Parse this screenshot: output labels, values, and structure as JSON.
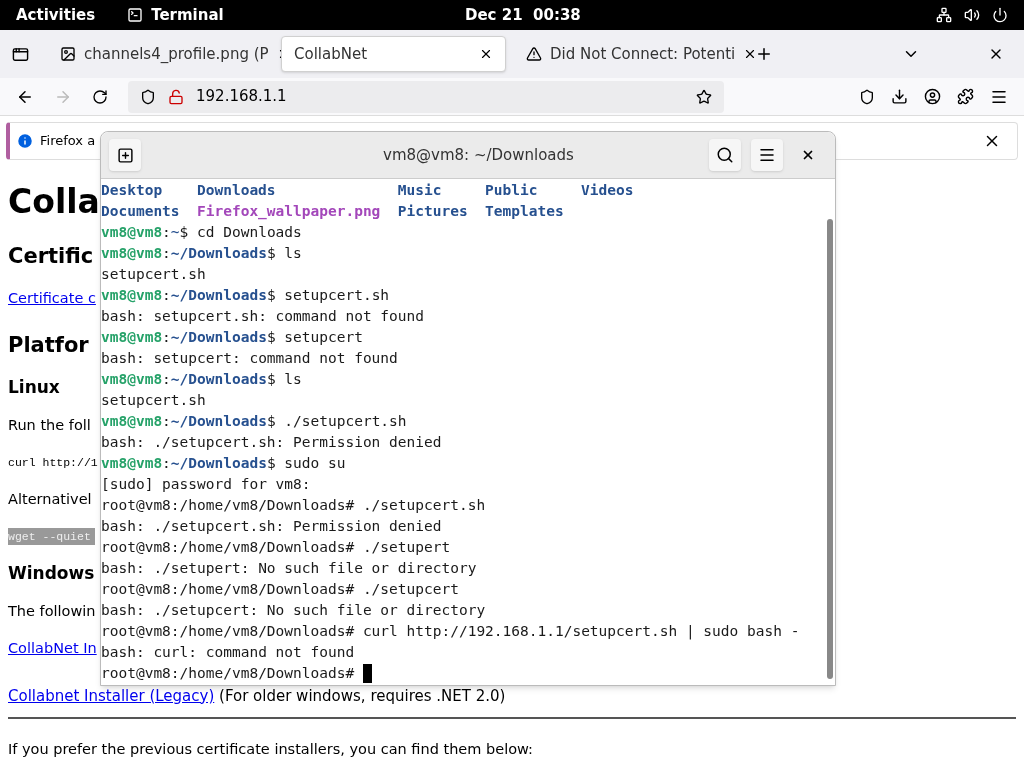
{
  "top_bar": {
    "activities": "Activities",
    "app": "Terminal",
    "clock": "Dec 21  00:38"
  },
  "browser": {
    "tabs": [
      {
        "title": "channels4_profile.png (P",
        "kind": "image",
        "selected": false
      },
      {
        "title": "CollabNet",
        "kind": "page",
        "selected": true
      },
      {
        "title": "Did Not Connect: Potenti",
        "kind": "warning",
        "selected": false
      }
    ],
    "forward_disabled": true,
    "url": "192.168.1.1",
    "notification": "Firefox a"
  },
  "page": {
    "blocks": [
      {
        "kind": "h1",
        "text": "Colla"
      },
      {
        "kind": "h2",
        "text": "Certific"
      },
      {
        "kind": "link",
        "text": "Certificate c"
      },
      {
        "kind": "h2",
        "text": "Platfor"
      },
      {
        "kind": "h3",
        "text": "Linux"
      },
      {
        "kind": "p",
        "text": "Run the foll"
      },
      {
        "kind": "code",
        "text": "curl http://1"
      },
      {
        "kind": "p",
        "text": "Alternativel"
      },
      {
        "kind": "pre",
        "text": "wget --quiet"
      },
      {
        "kind": "h3",
        "text": "Windows"
      },
      {
        "kind": "p",
        "text": "The followin"
      },
      {
        "kind": "link",
        "text": "CollabNet In"
      },
      {
        "kind": "linkline",
        "text": "Collabnet Installer (Legacy)",
        "rest": " (For older windows, requires .NET 2.0)"
      },
      {
        "kind": "hr"
      },
      {
        "kind": "p",
        "text": "If you prefer the previous certificate installers, you can find them below:"
      }
    ]
  },
  "terminal": {
    "title": "vm8@vm8: ~/Downloads",
    "lines": [
      {
        "kind": "ls",
        "items": [
          {
            "text": "Desktop",
            "kind": "dir"
          },
          {
            "text": "Downloads",
            "kind": "dir"
          },
          {
            "text": "Music",
            "kind": "dir"
          },
          {
            "text": "Public",
            "kind": "dir"
          },
          {
            "text": "Videos",
            "kind": "dir"
          }
        ]
      },
      {
        "kind": "ls",
        "items": [
          {
            "text": "Documents",
            "kind": "dir"
          },
          {
            "text": "Firefox_wallpaper.png",
            "kind": "image"
          },
          {
            "text": "Pictures",
            "kind": "dir"
          },
          {
            "text": "Templates",
            "kind": "dir"
          }
        ]
      },
      {
        "kind": "prompt",
        "user": "vm8@vm8",
        "sep": ":",
        "path": "~",
        "cmd": "$ cd Downloads"
      },
      {
        "kind": "prompt",
        "user": "vm8@vm8",
        "sep": ":",
        "path": "~/Downloads",
        "cmd": "$ ls"
      },
      {
        "kind": "out",
        "text": "setupcert.sh"
      },
      {
        "kind": "prompt",
        "user": "vm8@vm8",
        "sep": ":",
        "path": "~/Downloads",
        "cmd": "$ setupcert.sh"
      },
      {
        "kind": "out",
        "text": "bash: setupcert.sh: command not found"
      },
      {
        "kind": "prompt",
        "user": "vm8@vm8",
        "sep": ":",
        "path": "~/Downloads",
        "cmd": "$ setupcert"
      },
      {
        "kind": "out",
        "text": "bash: setupcert: command not found"
      },
      {
        "kind": "prompt",
        "user": "vm8@vm8",
        "sep": ":",
        "path": "~/Downloads",
        "cmd": "$ ls"
      },
      {
        "kind": "out",
        "text": "setupcert.sh"
      },
      {
        "kind": "prompt",
        "user": "vm8@vm8",
        "sep": ":",
        "path": "~/Downloads",
        "cmd": "$ ./setupcert.sh"
      },
      {
        "kind": "out",
        "text": "bash: ./setupcert.sh: Permission denied"
      },
      {
        "kind": "prompt",
        "user": "vm8@vm8",
        "sep": ":",
        "path": "~/Downloads",
        "cmd": "$ sudo su"
      },
      {
        "kind": "out",
        "text": "[sudo] password for vm8:"
      },
      {
        "kind": "out",
        "text": "root@vm8:/home/vm8/Downloads# ./setupcert.sh"
      },
      {
        "kind": "out",
        "text": "bash: ./setupcert.sh: Permission denied"
      },
      {
        "kind": "out",
        "text": "root@vm8:/home/vm8/Downloads# ./setupert"
      },
      {
        "kind": "out",
        "text": "bash: ./setupert: No such file or directory"
      },
      {
        "kind": "out",
        "text": "root@vm8:/home/vm8/Downloads# ./setupcert"
      },
      {
        "kind": "out",
        "text": "bash: ./setupcert: No such file or directory"
      },
      {
        "kind": "out",
        "text": "root@vm8:/home/vm8/Downloads# curl http://192.168.1.1/setupcert.sh | sudo bash -"
      },
      {
        "kind": "out",
        "text": "bash: curl: command not found"
      },
      {
        "kind": "cursor",
        "text": "root@vm8:/home/vm8/Downloads# "
      }
    ]
  }
}
